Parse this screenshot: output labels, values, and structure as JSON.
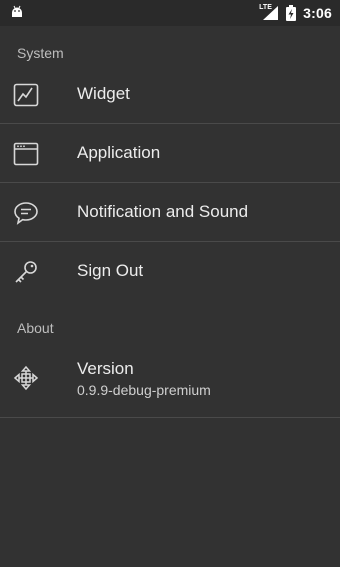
{
  "status_bar": {
    "left_icon": "android-icon",
    "network_label": "LTE",
    "battery_icon": "battery-charging-icon",
    "time": "3:06"
  },
  "sections": {
    "system": {
      "header": "System",
      "items": [
        {
          "label": "Widget",
          "icon": "chart-line-icon"
        },
        {
          "label": "Application",
          "icon": "window-icon"
        },
        {
          "label": "Notification and Sound",
          "icon": "chat-bubble-icon"
        },
        {
          "label": "Sign Out",
          "icon": "key-icon"
        }
      ]
    },
    "about": {
      "header": "About",
      "items": [
        {
          "label": "Version",
          "value": "0.9.9-debug-premium",
          "icon": "move-arrows-icon"
        }
      ]
    }
  },
  "colors": {
    "background": "#323232",
    "status_bar": "#2a2a2a",
    "divider": "#4a4a4a",
    "text_primary": "#ececec",
    "text_secondary": "#bdbdbd"
  }
}
